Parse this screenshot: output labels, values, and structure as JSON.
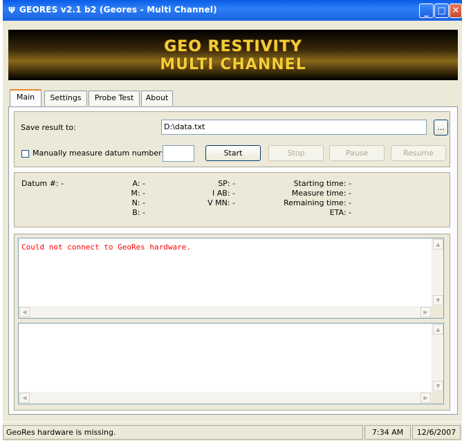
{
  "window": {
    "title": "GEORES v2.1 b2 (Geores - Multi Channel)",
    "app_icon": "tuning-fork-icon",
    "controls": {
      "minimize": "minimize-icon",
      "maximize": "maximize-icon",
      "close": "close-icon"
    }
  },
  "banner": {
    "line1": "GEO RESTIVITY",
    "line2": "MULTI CHANNEL"
  },
  "tabs": [
    {
      "label": "Main",
      "active": true
    },
    {
      "label": "Settings",
      "active": false
    },
    {
      "label": "Probe Test",
      "active": false
    },
    {
      "label": "About",
      "active": false
    }
  ],
  "save": {
    "label": "Save result to:",
    "path": "D:\\data.txt",
    "browse_label": "..."
  },
  "measure": {
    "checkbox_label": "Manually measure datum number:",
    "checked": false,
    "datum_number": "",
    "start_label": "Start",
    "stop_label": "Stop",
    "pause_label": "Pause",
    "resume_label": "Resume"
  },
  "info": {
    "datum": "Datum #:  -",
    "a": "A:  -",
    "m": "M:  -",
    "n": "N:  -",
    "b": "B:  -",
    "sp": "SP:  -",
    "iab": "I AB:  -",
    "vmn": "V MN:  -",
    "starting_time": "Starting time:  -",
    "measure_time": "Measure time:  -",
    "remaining_time": "Remaining time:  -",
    "eta": "ETA:  -"
  },
  "log": {
    "message": "Could not connect to GeoRes hardware.",
    "message_color": "#ff0000"
  },
  "status": {
    "message": "GeoRes hardware is missing.",
    "time": "7:34 AM",
    "date": "12/6/2007"
  }
}
